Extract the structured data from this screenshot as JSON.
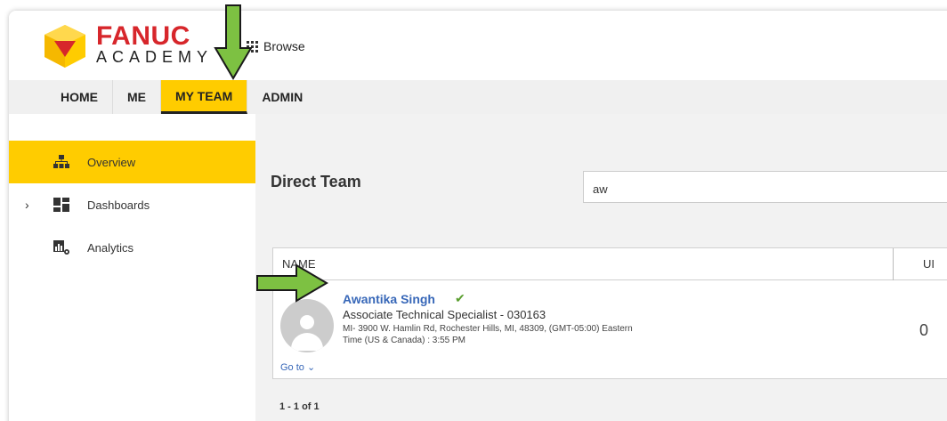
{
  "header": {
    "logo_top": "FANUC",
    "logo_bottom": "ACADEMY",
    "browse_label": "Browse"
  },
  "topnav": {
    "items": [
      {
        "label": "HOME",
        "active": false
      },
      {
        "label": "ME",
        "active": false
      },
      {
        "label": "MY TEAM",
        "active": true
      },
      {
        "label": "ADMIN",
        "active": false
      }
    ]
  },
  "sidebar": {
    "items": [
      {
        "label": "Overview",
        "icon": "org-chart-icon",
        "active": true
      },
      {
        "label": "Dashboards",
        "icon": "dashboard-icon",
        "active": false,
        "expandable": true
      },
      {
        "label": "Analytics",
        "icon": "analytics-icon",
        "active": false
      }
    ]
  },
  "main": {
    "title": "Direct Team",
    "search_value": "aw",
    "table": {
      "col_name": "NAME",
      "col_partial": "UI",
      "rows": [
        {
          "name": "Awantika Singh",
          "role": "Associate Technical Specialist - 030163",
          "location": "MI- 3900 W. Hamlin Rd, Rochester Hills, MI, 48309, (GMT-05:00) Eastern Time (US & Canada) : 3:55 PM",
          "goto": "Go to",
          "count": "0"
        }
      ]
    },
    "pager": "1 - 1 of 1"
  },
  "colors": {
    "accent": "#ffcc00",
    "brand_red": "#d7262b",
    "link": "#3767b8",
    "arrow": "#7dc142"
  }
}
